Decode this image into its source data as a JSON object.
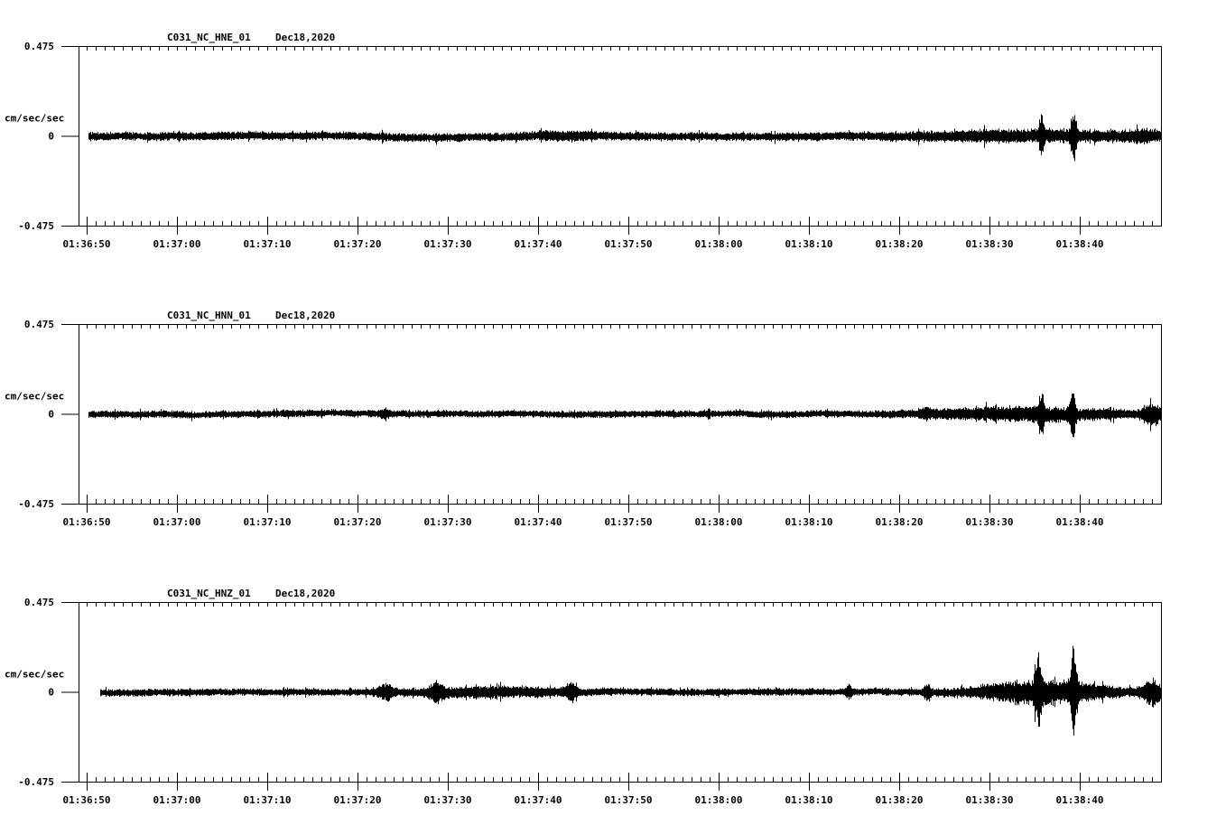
{
  "chart_data": [
    {
      "type": "line",
      "station": "C031_NC_HNE_01",
      "date": "Dec18,2020",
      "ylabel": "cm/sec/sec",
      "ylim": [
        -0.475,
        0.475
      ],
      "ytick_labels": [
        "0.475",
        "0",
        "-0.475"
      ],
      "xtick_labels": [
        "01:36:50",
        "01:37:00",
        "01:37:10",
        "01:37:20",
        "01:37:30",
        "01:37:40",
        "01:37:50",
        "01:38:00",
        "01:38:10",
        "01:38:20",
        "01:38:30",
        "01:38:40"
      ],
      "x_range_seconds_from_013650": [
        -0.9,
        119
      ],
      "data_start_seconds": 0.2,
      "noise_amplitude": 0.018,
      "bursts": [
        {
          "t": 53,
          "amp": 0.01,
          "w": 4
        },
        {
          "t": 104,
          "amp": 0.02,
          "w": 12
        },
        {
          "t": 105.7,
          "amp": 0.12,
          "w": 0.25
        },
        {
          "t": 109.3,
          "amp": 0.16,
          "w": 0.3
        },
        {
          "t": 117,
          "amp": 0.02,
          "w": 2
        }
      ]
    },
    {
      "type": "line",
      "station": "C031_NC_HNN_01",
      "date": "Dec18,2020",
      "ylabel": "cm/sec/sec",
      "ylim": [
        -0.475,
        0.475
      ],
      "ytick_labels": [
        "0.475",
        "0",
        "-0.475"
      ],
      "xtick_labels": [
        "01:36:50",
        "01:37:00",
        "01:37:10",
        "01:37:20",
        "01:37:30",
        "01:37:40",
        "01:37:50",
        "01:38:00",
        "01:38:10",
        "01:38:20",
        "01:38:30",
        "01:38:40"
      ],
      "x_range_seconds_from_013650": [
        -0.9,
        119
      ],
      "data_start_seconds": 0.2,
      "noise_amplitude": 0.015,
      "bursts": [
        {
          "t": 33,
          "amp": 0.02,
          "w": 0.6
        },
        {
          "t": 93,
          "amp": 0.02,
          "w": 0.4
        },
        {
          "t": 104,
          "amp": 0.03,
          "w": 10
        },
        {
          "t": 105.7,
          "amp": 0.11,
          "w": 0.3
        },
        {
          "t": 109.2,
          "amp": 0.13,
          "w": 0.3
        },
        {
          "t": 118,
          "amp": 0.05,
          "w": 1
        }
      ]
    },
    {
      "type": "line",
      "station": "C031_NC_HNZ_01",
      "date": "Dec18,2020",
      "ylabel": "cm/sec/sec",
      "ylim": [
        -0.475,
        0.475
      ],
      "ytick_labels": [
        "0.475",
        "0",
        "-0.475"
      ],
      "xtick_labels": [
        "01:36:50",
        "01:37:00",
        "01:37:10",
        "01:37:20",
        "01:37:30",
        "01:37:40",
        "01:37:50",
        "01:38:00",
        "01:38:10",
        "01:38:20",
        "01:38:30",
        "01:38:40"
      ],
      "x_range_seconds_from_013650": [
        -0.9,
        119
      ],
      "data_start_seconds": 1.5,
      "noise_amplitude": 0.015,
      "bursts": [
        {
          "t": 33.1,
          "amp": 0.04,
          "w": 0.8
        },
        {
          "t": 38.7,
          "amp": 0.04,
          "w": 0.8
        },
        {
          "t": 45,
          "amp": 0.02,
          "w": 8
        },
        {
          "t": 53.6,
          "amp": 0.05,
          "w": 0.6
        },
        {
          "t": 84.4,
          "amp": 0.03,
          "w": 0.4
        },
        {
          "t": 93.1,
          "amp": 0.04,
          "w": 0.4
        },
        {
          "t": 106,
          "amp": 0.06,
          "w": 7
        },
        {
          "t": 105.4,
          "amp": 0.17,
          "w": 0.4
        },
        {
          "t": 109.3,
          "amp": 0.24,
          "w": 0.35
        },
        {
          "t": 118,
          "amp": 0.06,
          "w": 1.2
        }
      ]
    }
  ]
}
